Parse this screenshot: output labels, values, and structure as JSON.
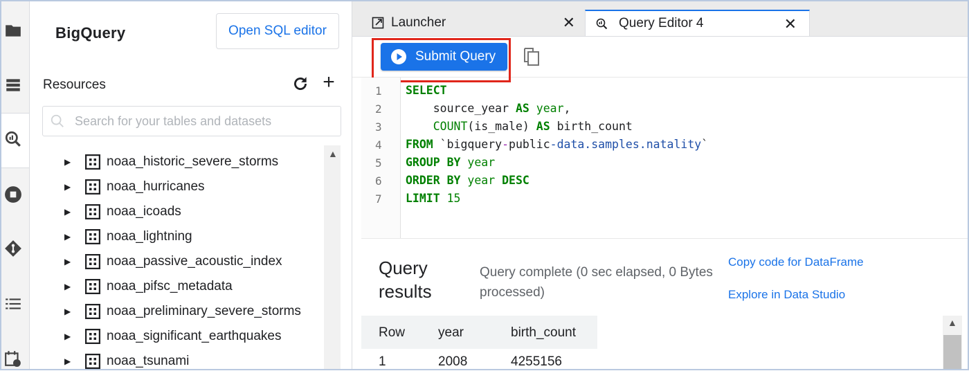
{
  "activity_bar": {
    "icons": [
      "folder-icon",
      "list-icon",
      "query-search-icon",
      "stop-icon",
      "git-icon",
      "bullet-list-icon",
      "calendar-clock-icon"
    ]
  },
  "sidebar": {
    "brand": "BigQuery",
    "open_sql_editor": "Open SQL editor",
    "resources_label": "Resources",
    "search_placeholder": "Search for your tables and datasets",
    "datasets": [
      "noaa_historic_severe_storms",
      "noaa_hurricanes",
      "noaa_icoads",
      "noaa_lightning",
      "noaa_passive_acoustic_index",
      "noaa_pifsc_metadata",
      "noaa_preliminary_severe_storms",
      "noaa_significant_earthquakes",
      "noaa_tsunami"
    ]
  },
  "tabs": [
    {
      "label": "Launcher",
      "icon": "launcher-icon",
      "active": false
    },
    {
      "label": "Query Editor 4",
      "icon": "query-icon",
      "active": true
    }
  ],
  "toolbar": {
    "submit_label": "Submit Query"
  },
  "editor": {
    "line_numbers": [
      "1",
      "2",
      "3",
      "4",
      "5",
      "6",
      "7"
    ]
  },
  "results": {
    "title": "Query results",
    "status": "Query complete (0 sec elapsed, 0 Bytes processed)",
    "copy_link": "Copy code for DataFrame",
    "studio_link": "Explore in Data Studio",
    "columns": [
      "Row",
      "year",
      "birth_count"
    ],
    "rows": [
      [
        "1",
        "2008",
        "4255156"
      ]
    ]
  },
  "colors": {
    "accent": "#1a73e8",
    "highlight": "#e0261b",
    "keyword": "#008000"
  }
}
